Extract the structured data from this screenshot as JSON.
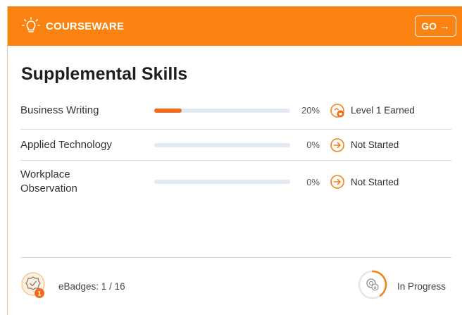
{
  "header": {
    "title": "COURSEWARE",
    "go_label": "GO",
    "go_arrow": "→",
    "icon": "lightbulb-icon",
    "color": "#f98211"
  },
  "page_title": "Supplemental Skills",
  "skills": [
    {
      "name": "Business Writing",
      "progress": 0.2,
      "percent": "20%",
      "status": "Level 1 Earned",
      "status_icon": "level-earned-icon"
    },
    {
      "name": "Applied Technology",
      "progress": 0,
      "percent": "0%",
      "status": "Not Started",
      "status_icon": "arrow-right-circle-icon"
    },
    {
      "name": "Workplace Observation",
      "progress": 0,
      "percent": "0%",
      "status": "Not Started",
      "status_icon": "arrow-right-circle-icon"
    }
  ],
  "footer": {
    "ebadges_label": "eBadges: 1 / 16",
    "badge_count": "1",
    "status_label": "In Progress",
    "status_progress": 0.4
  },
  "colors": {
    "accent": "#f98211",
    "fill": "#f26b1d",
    "track": "#e4eaf1"
  }
}
